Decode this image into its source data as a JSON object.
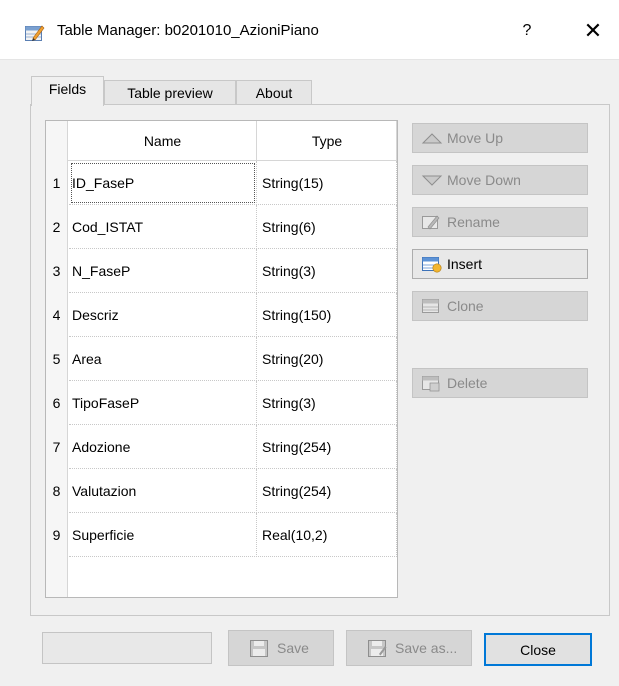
{
  "window": {
    "title": "Table Manager: b0201010_AzioniPiano",
    "help_label": "?",
    "close_label": "✕"
  },
  "tabs": [
    {
      "label": "Fields",
      "active": true
    },
    {
      "label": "Table preview",
      "active": false
    },
    {
      "label": "About",
      "active": false
    }
  ],
  "table": {
    "columns": [
      "Name",
      "Type"
    ],
    "rows": [
      {
        "index": "1",
        "name": "ID_FaseP",
        "type": "String(15)"
      },
      {
        "index": "2",
        "name": "Cod_ISTAT",
        "type": "String(6)"
      },
      {
        "index": "3",
        "name": "N_FaseP",
        "type": "String(3)"
      },
      {
        "index": "4",
        "name": "Descriz",
        "type": "String(150)"
      },
      {
        "index": "5",
        "name": "Area",
        "type": "String(20)"
      },
      {
        "index": "6",
        "name": "TipoFaseP",
        "type": "String(3)"
      },
      {
        "index": "7",
        "name": "Adozione",
        "type": "String(254)"
      },
      {
        "index": "8",
        "name": "Valutazion",
        "type": "String(254)"
      },
      {
        "index": "9",
        "name": "Superficie",
        "type": "Real(10,2)"
      }
    ]
  },
  "side_buttons": {
    "move_up": "Move Up",
    "move_down": "Move Down",
    "rename": "Rename",
    "insert": "Insert",
    "clone": "Clone",
    "delete": "Delete"
  },
  "bottom_buttons": {
    "save": "Save",
    "save_as": "Save as...",
    "close": "Close"
  },
  "colors": {
    "accent": "#0078d7",
    "disabled_text": "#8a8a8a",
    "disabled_bg": "#d6d6d6"
  }
}
